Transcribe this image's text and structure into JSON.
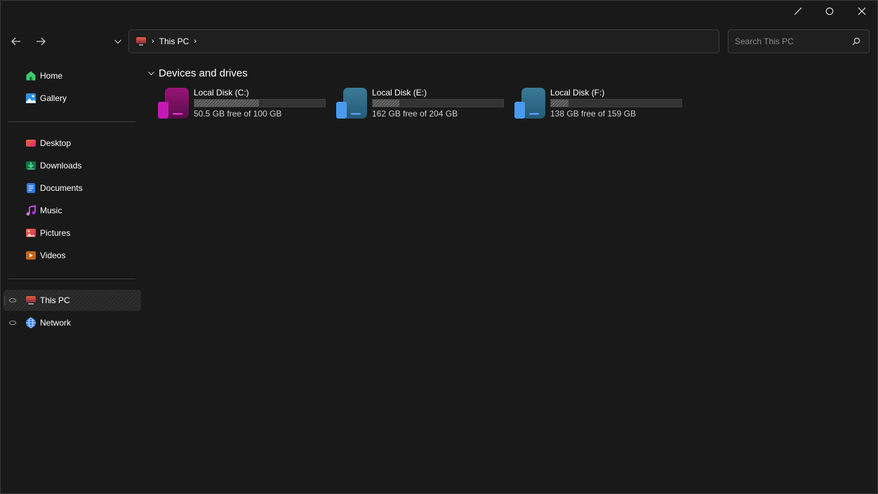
{
  "window": {
    "controls": [
      "minimize-icon",
      "maximize-icon",
      "close-icon"
    ]
  },
  "nav": {
    "back_icon": "arrow-left-icon",
    "forward_icon": "arrow-right-icon",
    "recent_icon": "chevron-down-icon"
  },
  "address": {
    "root_icon": "this-pc-icon",
    "crumbs": [
      "This PC"
    ]
  },
  "search": {
    "placeholder": "Search This PC",
    "icon": "search-icon"
  },
  "sidebar": {
    "quick": [
      {
        "label": "Home",
        "icon": "home-icon"
      },
      {
        "label": "Gallery",
        "icon": "gallery-icon"
      }
    ],
    "folders": [
      {
        "label": "Desktop",
        "icon": "desktop-folder-icon"
      },
      {
        "label": "Downloads",
        "icon": "downloads-folder-icon"
      },
      {
        "label": "Documents",
        "icon": "documents-folder-icon"
      },
      {
        "label": "Music",
        "icon": "music-folder-icon"
      },
      {
        "label": "Pictures",
        "icon": "pictures-folder-icon"
      },
      {
        "label": "Videos",
        "icon": "videos-folder-icon"
      }
    ],
    "locations": [
      {
        "label": "This PC",
        "icon": "this-pc-icon",
        "selected": true
      },
      {
        "label": "Network",
        "icon": "network-icon",
        "selected": false
      }
    ]
  },
  "main": {
    "section_title": "Devices and drives",
    "drives": [
      {
        "name": "Local Disk (C:)",
        "free_text": "50.5 GB free of 100 GB",
        "used_fraction": 0.495,
        "icon": "drive-c-icon",
        "accent": "#c2189c"
      },
      {
        "name": "Local Disk (E:)",
        "free_text": "162 GB free of 204 GB",
        "used_fraction": 0.206,
        "icon": "drive-e-icon",
        "accent": "#4a90e2"
      },
      {
        "name": "Local Disk (F:)",
        "free_text": "138 GB free of 159 GB",
        "used_fraction": 0.132,
        "icon": "drive-f-icon",
        "accent": "#4a90e2"
      }
    ]
  },
  "colors": {
    "background": "#191919",
    "border": "#3c3c3c"
  }
}
